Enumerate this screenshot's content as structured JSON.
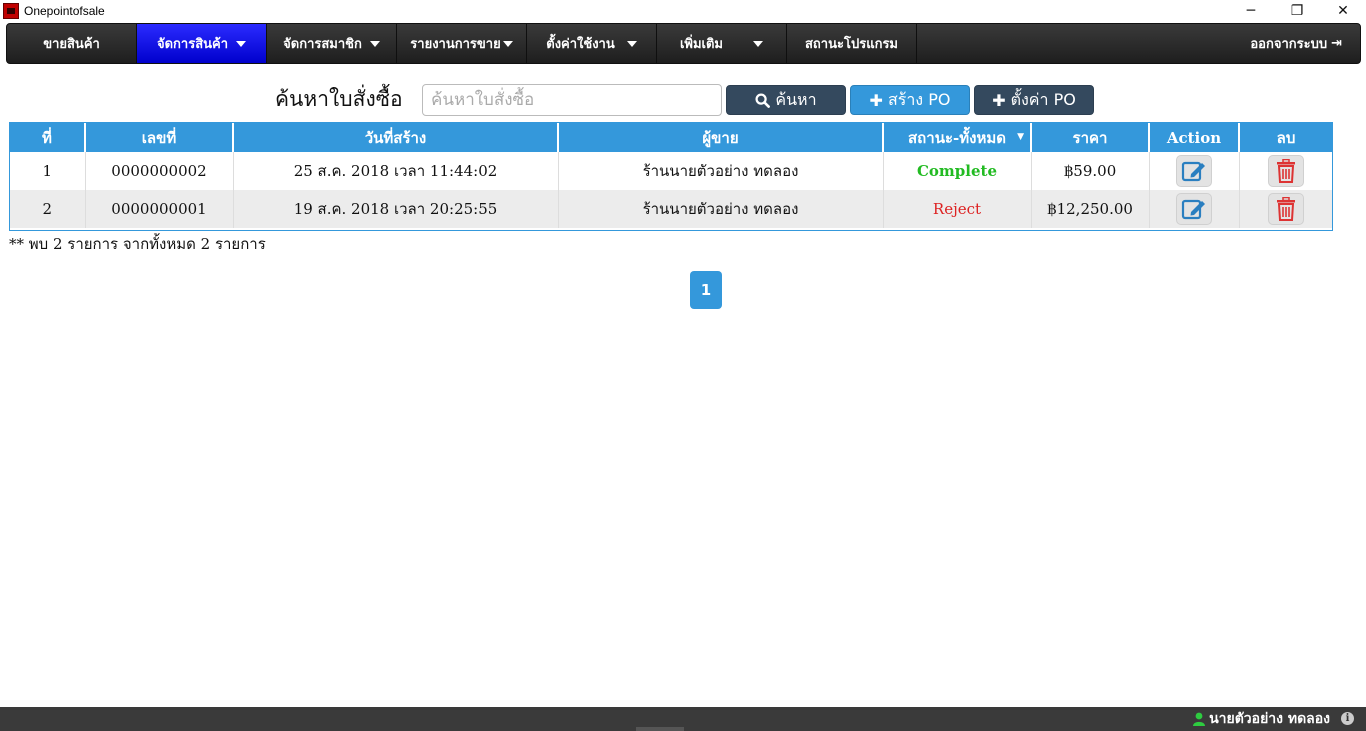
{
  "window": {
    "title": "Onepointofsale",
    "minimize": "─",
    "restore": "❐",
    "close": "✕"
  },
  "nav": {
    "items": [
      {
        "label": "ขายสินค้า",
        "caret": false,
        "active": false
      },
      {
        "label": "จัดการสินค้า",
        "caret": true,
        "active": true
      },
      {
        "label": "จัดการสมาชิก",
        "caret": true,
        "active": false
      },
      {
        "label": "รายงานการขาย",
        "caret": true,
        "active": false
      },
      {
        "label": "ตั้งค่าใช้งาน",
        "caret": true,
        "active": false
      },
      {
        "label": "เพิ่มเติม",
        "caret": true,
        "active": false
      },
      {
        "label": "สถานะโปรแกรม",
        "caret": false,
        "active": false
      }
    ],
    "logout_label": "ออกจากระบบ"
  },
  "search": {
    "label": "ค้นหาใบสั่งซื้อ",
    "placeholder": "ค้นหาใบสั่งซื้อ",
    "value": "",
    "search_button": "ค้นหา",
    "create_button": "สร้าง PO",
    "settings_button": "ตั้งค่า PO"
  },
  "table": {
    "headers": {
      "no": "ที่",
      "number": "เลขที่",
      "created": "วันที่สร้าง",
      "seller": "ผู้ขาย",
      "status": "สถานะ-ทั้งหมด",
      "price": "ราคา",
      "action": "Action",
      "delete": "ลบ"
    },
    "rows": [
      {
        "no": "1",
        "number": "0000000002",
        "created": "25 ส.ค. 2018 เวลา 11:44:02",
        "seller": "ร้านนายตัวอย่าง ทดลอง",
        "status": "Complete",
        "price": "฿59.00"
      },
      {
        "no": "2",
        "number": "0000000001",
        "created": "19 ส.ค. 2018 เวลา 20:25:55",
        "seller": "ร้านนายตัวอย่าง ทดลอง",
        "status": "Reject",
        "price": "฿12,250.00"
      }
    ]
  },
  "summary": "** พบ 2 รายการ จากทั้งหมด 2 รายการ",
  "pagination": {
    "current": "1"
  },
  "statusbar": {
    "user": "นายตัวอย่าง ทดลอง"
  },
  "colors": {
    "accent": "#3498db",
    "nav_active": "#0000ff",
    "complete": "#22bb22",
    "reject": "#dd2222"
  }
}
